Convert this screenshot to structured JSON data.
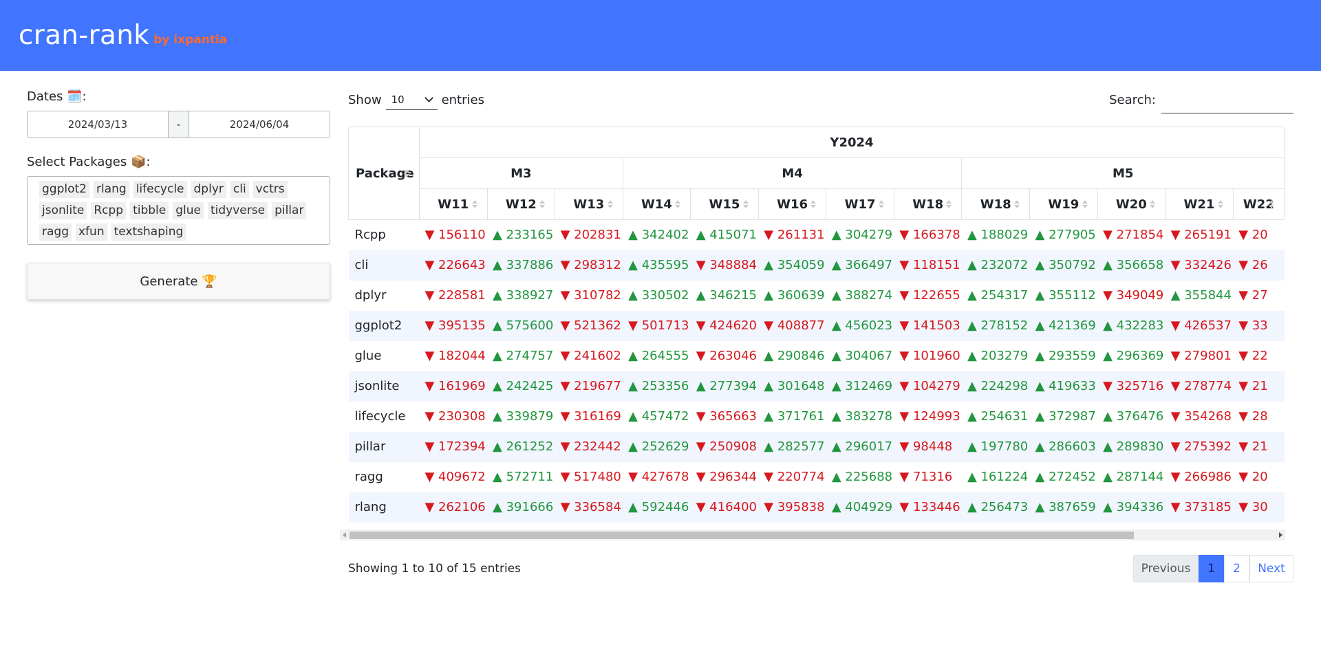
{
  "header": {
    "title": "cran-rank",
    "byline": "by ixpantia"
  },
  "sidebar": {
    "dates_label": "Dates 🗓️:",
    "date_start": "2024/03/13",
    "date_sep": "-",
    "date_end": "2024/06/04",
    "packages_label": "Select Packages 📦:",
    "packages": [
      "ggplot2",
      "rlang",
      "lifecycle",
      "dplyr",
      "cli",
      "vctrs",
      "jsonlite",
      "Rcpp",
      "tibble",
      "glue",
      "tidyverse",
      "pillar",
      "ragg",
      "xfun",
      "textshaping"
    ],
    "generate_label": "Generate 🏆"
  },
  "table_controls": {
    "show_label": "Show",
    "entries_label": "entries",
    "length_value": "10",
    "search_label": "Search:"
  },
  "table": {
    "year": "Y2024",
    "months": [
      {
        "label": "M3",
        "span": 3
      },
      {
        "label": "M4",
        "span": 5
      },
      {
        "label": "M5",
        "span": 5
      }
    ],
    "package_header": "Package",
    "weeks": [
      "W11",
      "W12",
      "W13",
      "W14",
      "W15",
      "W16",
      "W17",
      "W18",
      "W18",
      "W19",
      "W20",
      "W21",
      "W22"
    ],
    "rows": [
      {
        "pkg": "Rcpp",
        "cells": [
          [
            "down",
            "156110"
          ],
          [
            "up",
            "233165"
          ],
          [
            "down",
            "202831"
          ],
          [
            "up",
            "342402"
          ],
          [
            "up",
            "415071"
          ],
          [
            "down",
            "261131"
          ],
          [
            "up",
            "304279"
          ],
          [
            "down",
            "166378"
          ],
          [
            "up",
            "188029"
          ],
          [
            "up",
            "277905"
          ],
          [
            "down",
            "271854"
          ],
          [
            "down",
            "265191"
          ],
          [
            "down",
            "20"
          ]
        ]
      },
      {
        "pkg": "cli",
        "cells": [
          [
            "down",
            "226643"
          ],
          [
            "up",
            "337886"
          ],
          [
            "down",
            "298312"
          ],
          [
            "up",
            "435595"
          ],
          [
            "down",
            "348884"
          ],
          [
            "up",
            "354059"
          ],
          [
            "up",
            "366497"
          ],
          [
            "down",
            "118151"
          ],
          [
            "up",
            "232072"
          ],
          [
            "up",
            "350792"
          ],
          [
            "up",
            "356658"
          ],
          [
            "down",
            "332426"
          ],
          [
            "down",
            "26"
          ]
        ]
      },
      {
        "pkg": "dplyr",
        "cells": [
          [
            "down",
            "228581"
          ],
          [
            "up",
            "338927"
          ],
          [
            "down",
            "310782"
          ],
          [
            "up",
            "330502"
          ],
          [
            "up",
            "346215"
          ],
          [
            "up",
            "360639"
          ],
          [
            "up",
            "388274"
          ],
          [
            "down",
            "122655"
          ],
          [
            "up",
            "254317"
          ],
          [
            "up",
            "355112"
          ],
          [
            "down",
            "349049"
          ],
          [
            "up",
            "355844"
          ],
          [
            "down",
            "27"
          ]
        ]
      },
      {
        "pkg": "ggplot2",
        "cells": [
          [
            "down",
            "395135"
          ],
          [
            "up",
            "575600"
          ],
          [
            "down",
            "521362"
          ],
          [
            "down",
            "501713"
          ],
          [
            "down",
            "424620"
          ],
          [
            "down",
            "408877"
          ],
          [
            "up",
            "456023"
          ],
          [
            "down",
            "141503"
          ],
          [
            "up",
            "278152"
          ],
          [
            "up",
            "421369"
          ],
          [
            "up",
            "432283"
          ],
          [
            "down",
            "426537"
          ],
          [
            "down",
            "33"
          ]
        ]
      },
      {
        "pkg": "glue",
        "cells": [
          [
            "down",
            "182044"
          ],
          [
            "up",
            "274757"
          ],
          [
            "down",
            "241602"
          ],
          [
            "up",
            "264555"
          ],
          [
            "down",
            "263046"
          ],
          [
            "up",
            "290846"
          ],
          [
            "up",
            "304067"
          ],
          [
            "down",
            "101960"
          ],
          [
            "up",
            "203279"
          ],
          [
            "up",
            "293559"
          ],
          [
            "up",
            "296369"
          ],
          [
            "down",
            "279801"
          ],
          [
            "down",
            "22"
          ]
        ]
      },
      {
        "pkg": "jsonlite",
        "cells": [
          [
            "down",
            "161969"
          ],
          [
            "up",
            "242425"
          ],
          [
            "down",
            "219677"
          ],
          [
            "up",
            "253356"
          ],
          [
            "up",
            "277394"
          ],
          [
            "up",
            "301648"
          ],
          [
            "up",
            "312469"
          ],
          [
            "down",
            "104279"
          ],
          [
            "up",
            "224298"
          ],
          [
            "up",
            "419633"
          ],
          [
            "down",
            "325716"
          ],
          [
            "down",
            "278774"
          ],
          [
            "down",
            "21"
          ]
        ]
      },
      {
        "pkg": "lifecycle",
        "cells": [
          [
            "down",
            "230308"
          ],
          [
            "up",
            "339879"
          ],
          [
            "down",
            "316169"
          ],
          [
            "up",
            "457472"
          ],
          [
            "down",
            "365663"
          ],
          [
            "up",
            "371761"
          ],
          [
            "up",
            "383278"
          ],
          [
            "down",
            "124993"
          ],
          [
            "up",
            "254631"
          ],
          [
            "up",
            "372987"
          ],
          [
            "up",
            "376476"
          ],
          [
            "down",
            "354268"
          ],
          [
            "down",
            "28"
          ]
        ]
      },
      {
        "pkg": "pillar",
        "cells": [
          [
            "down",
            "172394"
          ],
          [
            "up",
            "261252"
          ],
          [
            "down",
            "232442"
          ],
          [
            "up",
            "252629"
          ],
          [
            "down",
            "250908"
          ],
          [
            "up",
            "282577"
          ],
          [
            "up",
            "296017"
          ],
          [
            "down",
            "98448"
          ],
          [
            "up",
            "197780"
          ],
          [
            "up",
            "286603"
          ],
          [
            "up",
            "289830"
          ],
          [
            "down",
            "275392"
          ],
          [
            "down",
            "21"
          ]
        ]
      },
      {
        "pkg": "ragg",
        "cells": [
          [
            "down",
            "409672"
          ],
          [
            "up",
            "572711"
          ],
          [
            "down",
            "517480"
          ],
          [
            "down",
            "427678"
          ],
          [
            "down",
            "296344"
          ],
          [
            "down",
            "220774"
          ],
          [
            "up",
            "225688"
          ],
          [
            "down",
            "71316"
          ],
          [
            "up",
            "161224"
          ],
          [
            "up",
            "272452"
          ],
          [
            "up",
            "287144"
          ],
          [
            "down",
            "266986"
          ],
          [
            "down",
            "20"
          ]
        ]
      },
      {
        "pkg": "rlang",
        "cells": [
          [
            "down",
            "262106"
          ],
          [
            "up",
            "391666"
          ],
          [
            "down",
            "336584"
          ],
          [
            "up",
            "592446"
          ],
          [
            "down",
            "416400"
          ],
          [
            "down",
            "395838"
          ],
          [
            "up",
            "404929"
          ],
          [
            "down",
            "133446"
          ],
          [
            "up",
            "256473"
          ],
          [
            "up",
            "387659"
          ],
          [
            "up",
            "394336"
          ],
          [
            "down",
            "373185"
          ],
          [
            "down",
            "30"
          ]
        ]
      }
    ]
  },
  "footer": {
    "info": "Showing 1 to 10 of 15 entries",
    "prev_label": "Previous",
    "pages": [
      "1",
      "2"
    ],
    "next_label": "Next"
  },
  "colors": {
    "navbar": "#4174ff",
    "accent": "#ff6a2b",
    "up": "#22963f",
    "down": "#d7191f"
  }
}
